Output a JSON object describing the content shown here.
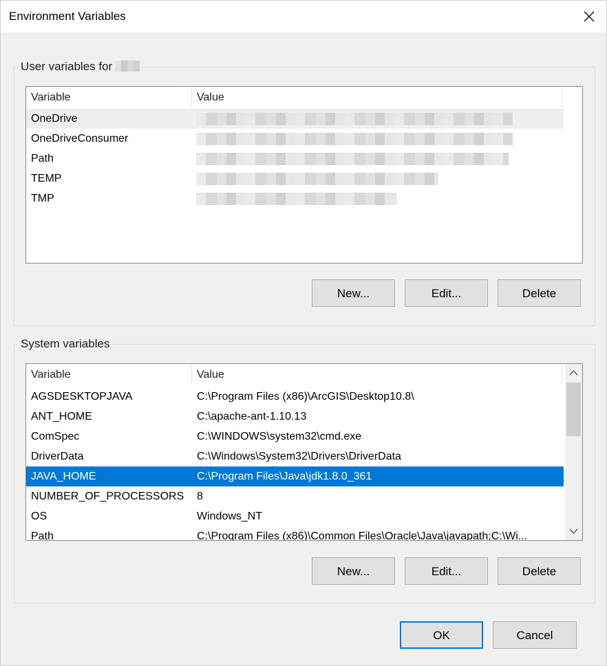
{
  "window": {
    "title": "Environment Variables",
    "close_icon": "close-icon"
  },
  "user_vars": {
    "group_label": "User variables for",
    "headers": {
      "variable": "Variable",
      "value": "Value"
    },
    "rows": [
      {
        "name": "OneDrive",
        "value": ""
      },
      {
        "name": "OneDriveConsumer",
        "value": ""
      },
      {
        "name": "Path",
        "value": ""
      },
      {
        "name": "TEMP",
        "value": ""
      },
      {
        "name": "TMP",
        "value": ""
      }
    ],
    "buttons": {
      "new": "New...",
      "edit": "Edit...",
      "delete": "Delete"
    }
  },
  "system_vars": {
    "group_label": "System variables",
    "headers": {
      "variable": "Variable",
      "value": "Value"
    },
    "rows": [
      {
        "name": "AGSDESKTOPJAVA",
        "value": "C:\\Program Files (x86)\\ArcGIS\\Desktop10.8\\"
      },
      {
        "name": "ANT_HOME",
        "value": "C:\\apache-ant-1.10.13"
      },
      {
        "name": "ComSpec",
        "value": "C:\\WINDOWS\\system32\\cmd.exe"
      },
      {
        "name": "DriverData",
        "value": "C:\\Windows\\System32\\Drivers\\DriverData"
      },
      {
        "name": "JAVA_HOME",
        "value": "C:\\Program Files\\Java\\jdk1.8.0_361"
      },
      {
        "name": "NUMBER_OF_PROCESSORS",
        "value": "8"
      },
      {
        "name": "OS",
        "value": "Windows_NT"
      },
      {
        "name": "Path",
        "value": "C:\\Program Files (x86)\\Common Files\\Oracle\\Java\\javapath;C:\\Wi..."
      }
    ],
    "selected_row": "JAVA_HOME",
    "buttons": {
      "new": "New...",
      "edit": "Edit...",
      "delete": "Delete"
    }
  },
  "footer": {
    "ok": "OK",
    "cancel": "Cancel"
  },
  "colors": {
    "selection": "#0078d7",
    "hover": "#efefef",
    "button_face": "#e1e1e1"
  }
}
